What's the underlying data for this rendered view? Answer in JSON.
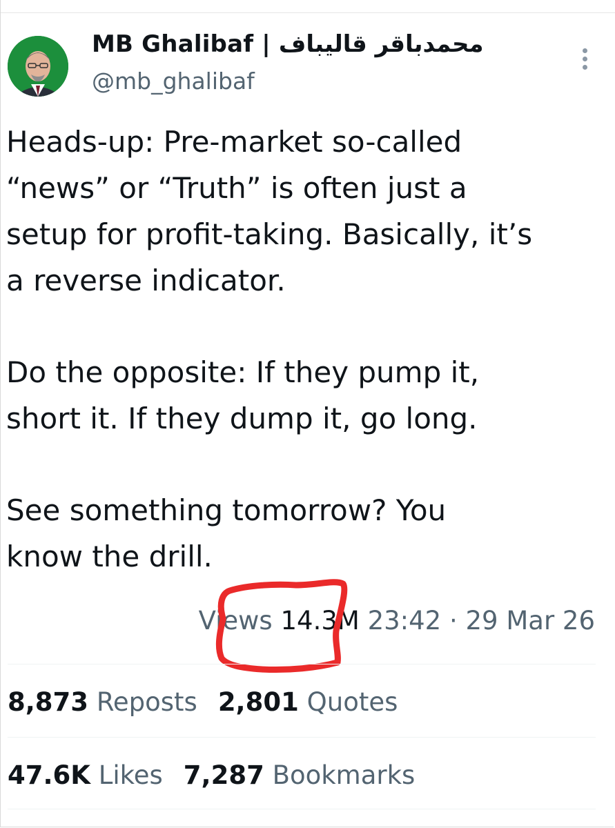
{
  "author": {
    "display_name": "MB Ghalibaf | محمدباقر قالیباف",
    "handle": "@mb_ghalibaf",
    "avatar_icon": "profile-photo"
  },
  "menu": {
    "icon": "more-vertical-icon"
  },
  "tweet": {
    "paragraph_1": "Heads-up: Pre-market so-called\n“news” or “Truth” is often just a\nsetup for profit-taking. Basically, it’s\na reverse indicator.",
    "paragraph_2": "Do the opposite: If they pump it,\nshort it. If they dump it, go long.",
    "paragraph_3": "See something tomorrow? You\nknow the drill."
  },
  "meta": {
    "views_label": "Views",
    "views_count": "14.3M",
    "time": "23:42",
    "separator": "·",
    "date": "29 Mar 26"
  },
  "stats": {
    "reposts_count": "8,873",
    "reposts_label": "Reposts",
    "quotes_count": "2,801",
    "quotes_label": "Quotes",
    "likes_count": "47.6K",
    "likes_label": "Likes",
    "bookmarks_count": "7,287",
    "bookmarks_label": "Bookmarks"
  },
  "colors": {
    "annotation": "#ea2a2a",
    "secondary_text": "#536471",
    "primary_text": "#0f1419"
  }
}
